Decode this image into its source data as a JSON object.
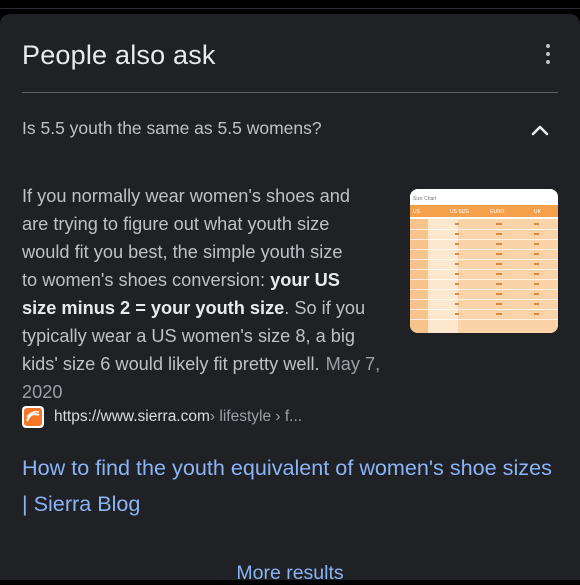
{
  "paa": {
    "title": "People also ask",
    "question": "Is 5.5 youth the same as 5.5 womens?",
    "answer": {
      "line1": "If you normally wear women's shoes and",
      "line2": "are trying to figure out what youth size",
      "line3": "would fit you best, the simple youth size",
      "line4a": "to women's shoes conversion: ",
      "line4b": "your US",
      "line5a": "size minus 2 = your youth size",
      "line5b": ". So if you",
      "line6": "typically wear a US women's size 8, a big",
      "line7": "kids' size 6 would likely fit pretty well.",
      "date": "May 7, 2020"
    },
    "thumbnail": {
      "caption": "Size Chart",
      "headers": [
        "US",
        "US SIZE",
        "EURO",
        "UK"
      ],
      "accent_color": "#f5a04a"
    },
    "source": {
      "favicon": "sierra-logo-icon",
      "url": "https://www.sierra.com",
      "path": " › lifestyle › f..."
    },
    "result_title": "How to find the youth equivalent of women's shoe sizes | Sierra Blog",
    "more_results": "More results"
  },
  "colors": {
    "card_bg": "#202124",
    "text": "#bdc1c6",
    "link": "#8ab4f8"
  }
}
